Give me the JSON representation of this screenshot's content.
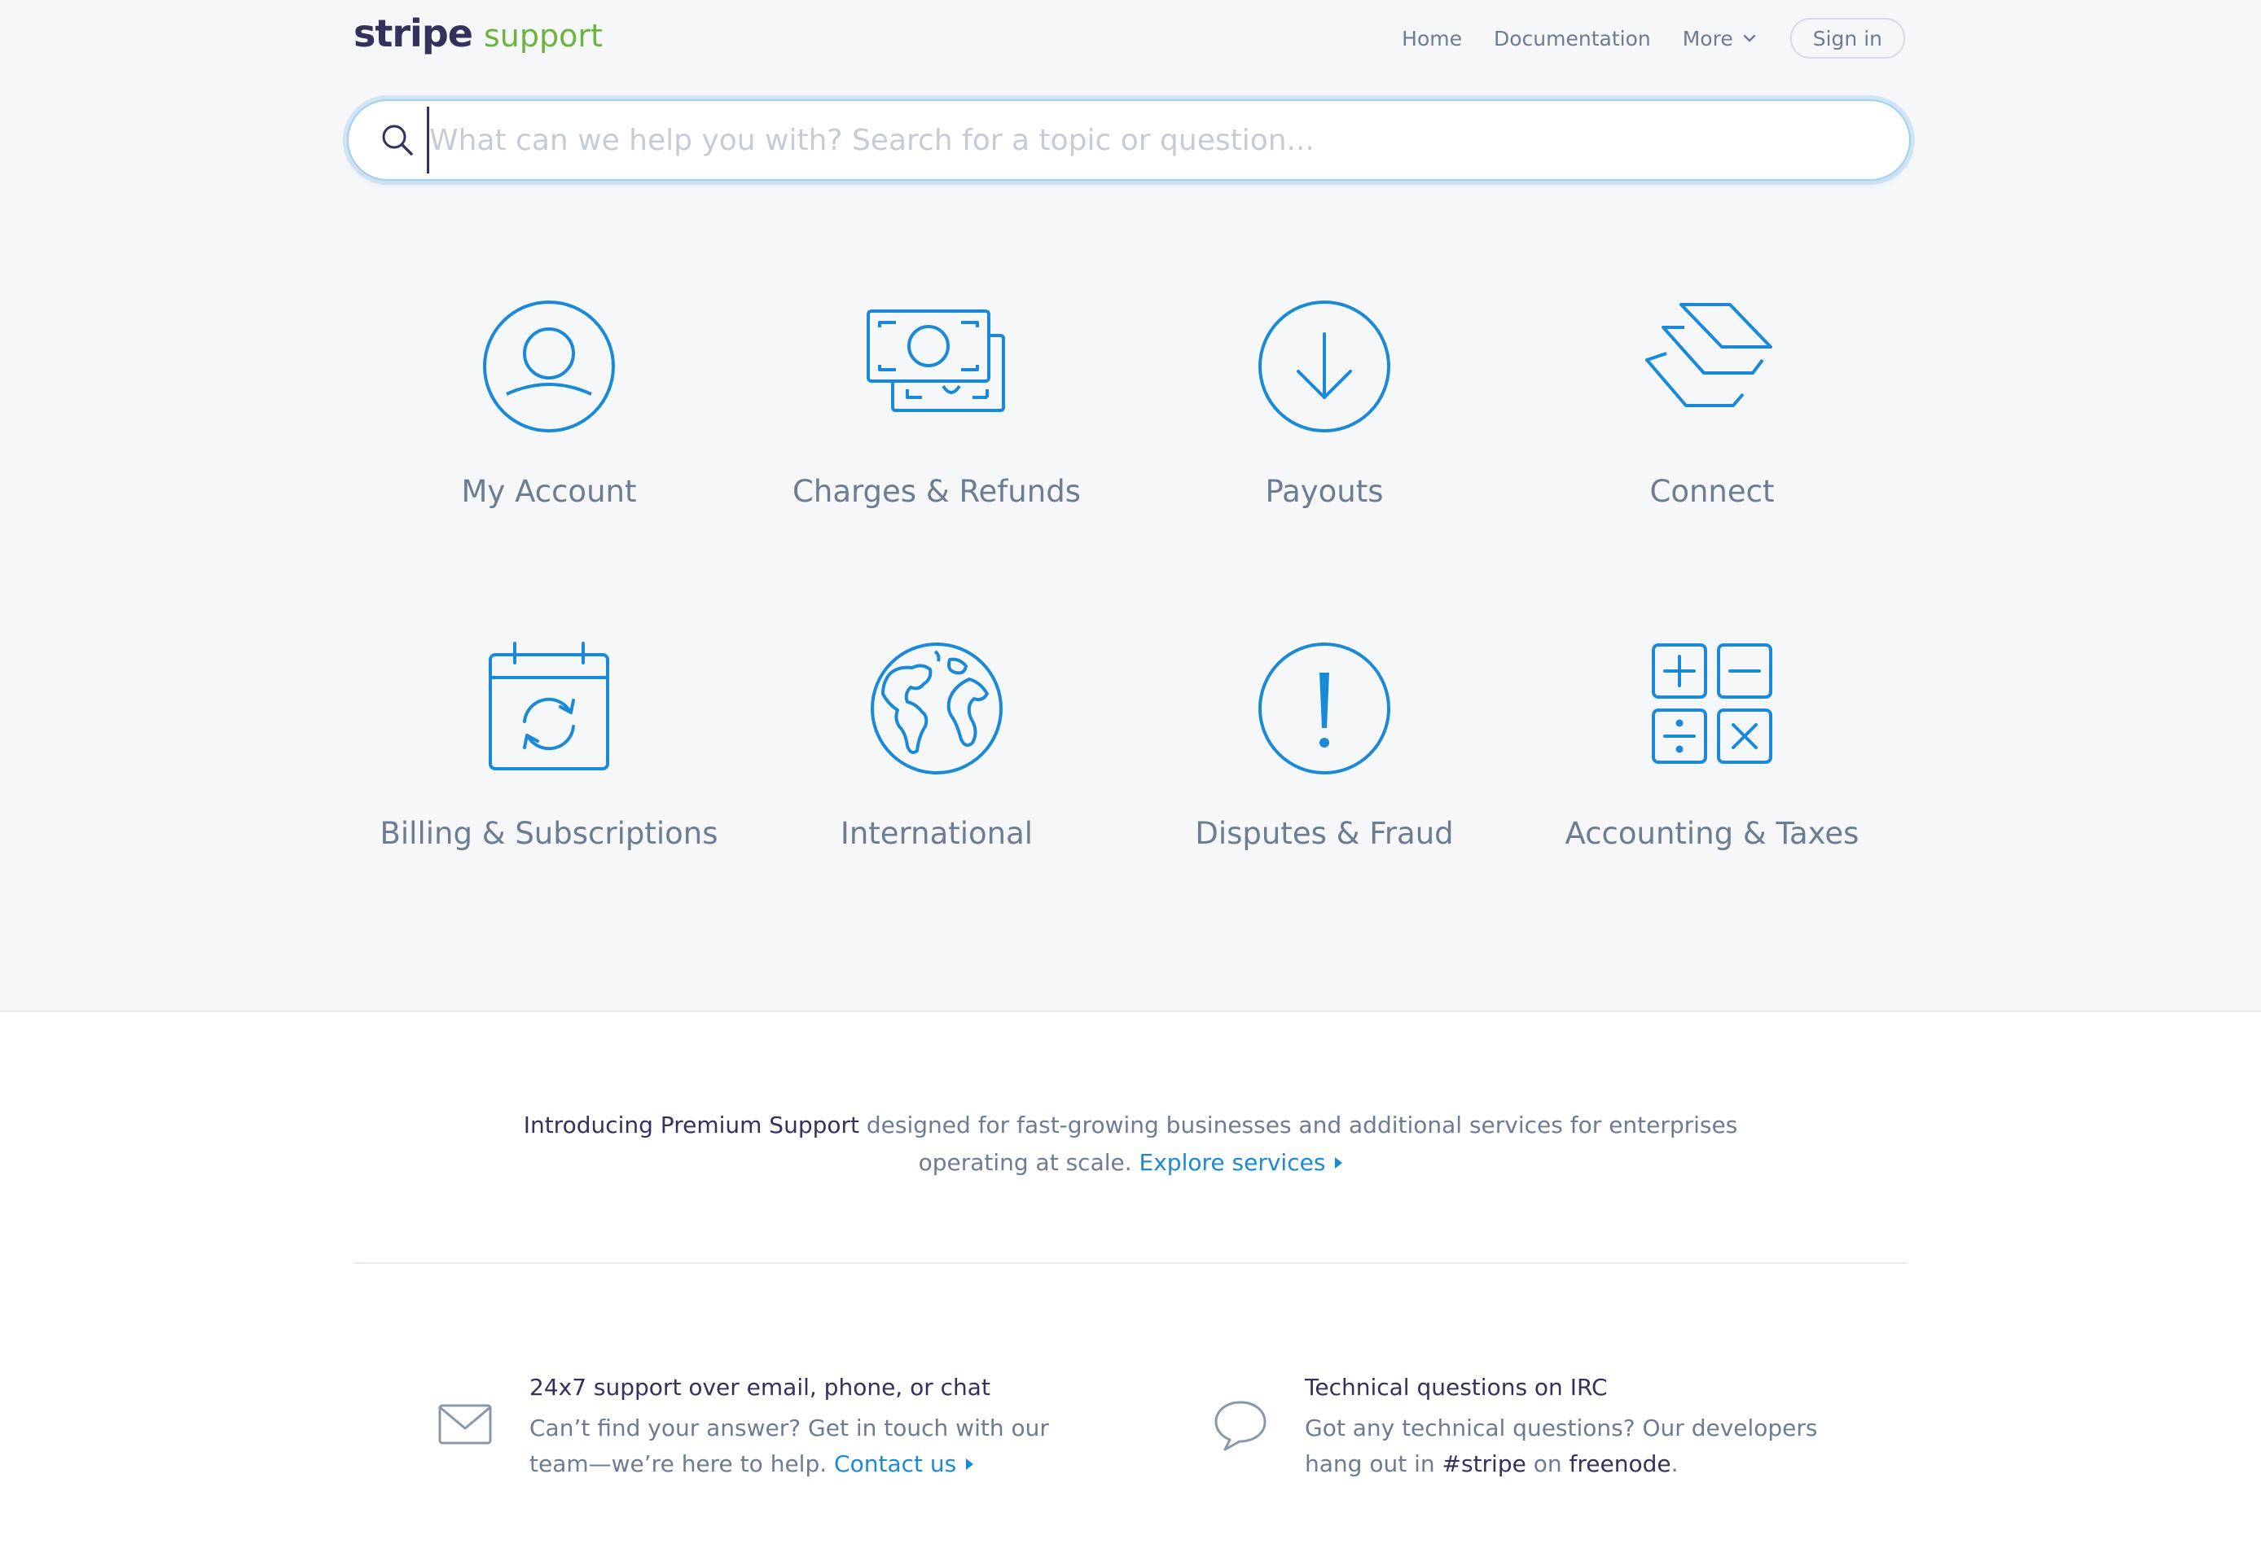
{
  "brand": {
    "name": "stripe",
    "product": "support",
    "color": "#32325d",
    "product_color": "#6db33f"
  },
  "nav": {
    "home": "Home",
    "documentation": "Documentation",
    "more": "More",
    "sign_in": "Sign in"
  },
  "search": {
    "placeholder": "What can we help you with? Search for a topic or question..."
  },
  "accent": "#1a8ad8",
  "categories": [
    {
      "label": "My Account",
      "icon": "user-icon"
    },
    {
      "label": "Charges & Refunds",
      "icon": "money-icon"
    },
    {
      "label": "Payouts",
      "icon": "download-icon"
    },
    {
      "label": "Connect",
      "icon": "layers-icon"
    },
    {
      "label": "Billing & Subscriptions",
      "icon": "calendar-refresh-icon"
    },
    {
      "label": "International",
      "icon": "globe-icon"
    },
    {
      "label": "Disputes & Fraud",
      "icon": "alert-icon"
    },
    {
      "label": "Accounting & Taxes",
      "icon": "calculator-icon"
    }
  ],
  "premium": {
    "highlight": "Introducing Premium Support",
    "text": "designed for fast-growing businesses and additional services for enterprises operating at scale.",
    "link": "Explore services"
  },
  "features": [
    {
      "icon": "mail-icon",
      "title": "24x7 support over email, phone, or chat",
      "text": "Can’t find your answer? Get in touch with our team—we’re here to help.",
      "link": "Contact us"
    },
    {
      "icon": "chat-bubble-icon",
      "title": "Technical questions on IRC",
      "text_before": "Got any technical questions? Our developers hang out in",
      "channel": "#stripe",
      "text_mid": "on",
      "network": "freenode",
      "text_after": "."
    }
  ]
}
